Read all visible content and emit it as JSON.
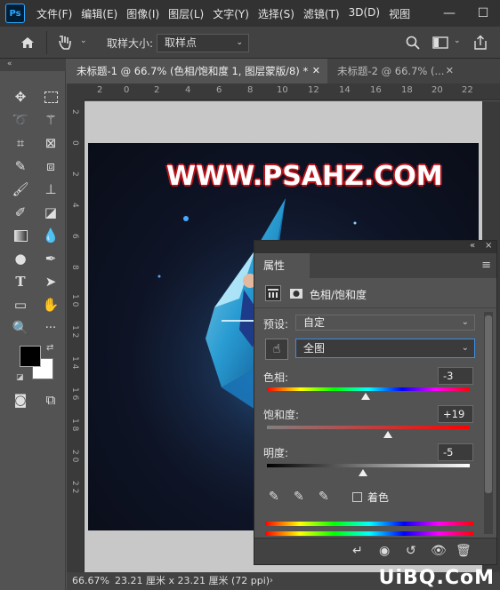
{
  "app": {
    "logo": "Ps"
  },
  "menu": [
    "文件(F)",
    "编辑(E)",
    "图像(I)",
    "图层(L)",
    "文字(Y)",
    "选择(S)",
    "滤镜(T)",
    "3D(D)",
    "视图"
  ],
  "window_controls": {
    "minimize": "—",
    "maximize": "☐"
  },
  "options": {
    "sample_size_label": "取样大小:",
    "sample_size_value": "取样点"
  },
  "toolbar": {
    "collapse": "«"
  },
  "tabs": [
    {
      "label": "未标题-1 @ 66.7% (色相/饱和度 1, 图层蒙版/8) *",
      "active": true
    },
    {
      "label": "未标题-2 @ 66.7% (...",
      "active": false
    }
  ],
  "ruler_top": [
    "2",
    "0",
    "2",
    "4",
    "6",
    "8",
    "10",
    "12",
    "14",
    "16",
    "18",
    "20",
    "22"
  ],
  "ruler_left": [
    "2",
    "0",
    "2",
    "4",
    "6",
    "8",
    "1\n0",
    "1\n2",
    "1\n4",
    "1\n6",
    "1\n8",
    "2\n0",
    "2\n2"
  ],
  "canvas": {
    "watermark_text": "WWW.PSAHZ.COM"
  },
  "status": {
    "zoom": "66.67%",
    "info": "23.21 厘米 x 23.21 厘米 (72 ppi)",
    "arrow": "›"
  },
  "site_watermark": "UiBQ.CoM",
  "properties": {
    "collapse": "«",
    "close": "×",
    "tab": "属性",
    "menu_icon": "≡",
    "adjustment_title": "色相/饱和度",
    "preset_label": "预设:",
    "preset_value": "自定",
    "channel_value": "全图",
    "hue": {
      "label": "色相:",
      "value": "-3",
      "fraction": 0.485
    },
    "saturation": {
      "label": "饱和度:",
      "value": "+19",
      "fraction": 0.595
    },
    "lightness": {
      "label": "明度:",
      "value": "-5",
      "fraction": 0.475
    },
    "colorize_label": "着色"
  },
  "colors": {
    "accent": "#31a8ff",
    "watermark_outline": "#b8141b",
    "crystal": "#3bb8ee"
  }
}
